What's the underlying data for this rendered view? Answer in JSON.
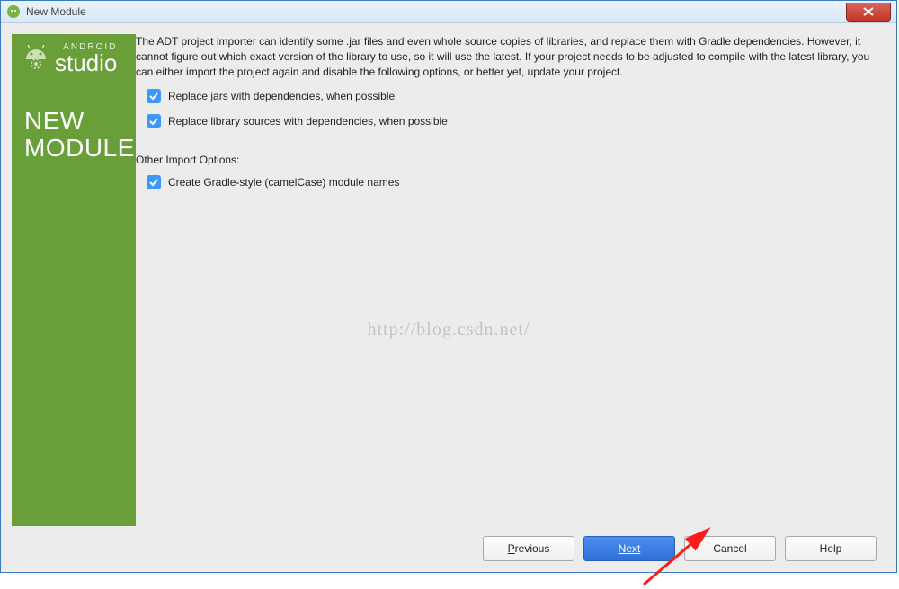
{
  "window": {
    "title": "New Module"
  },
  "sidebar": {
    "brand_small": "ANDROID",
    "brand_big": "studio",
    "title_line1": "NEW",
    "title_line2": "MODULE"
  },
  "pane": {
    "description": "The ADT project importer can identify some .jar files and even whole source copies of libraries, and replace them with Gradle dependencies. However, it cannot figure out which exact version of the library to use, so it will use the latest. If your project needs to be adjusted to compile with the latest library, you can either import the project again and disable the following options, or better yet, update your project.",
    "check_replace_jars": "Replace jars with dependencies, when possible",
    "check_replace_lib": "Replace library sources with dependencies, when possible",
    "other_import_label": "Other Import Options:",
    "check_camel": "Create Gradle-style (camelCase) module names"
  },
  "buttons": {
    "previous": "Previous",
    "next": "Next",
    "cancel": "Cancel",
    "help": "Help"
  },
  "watermark": "http://blog.csdn.net/"
}
